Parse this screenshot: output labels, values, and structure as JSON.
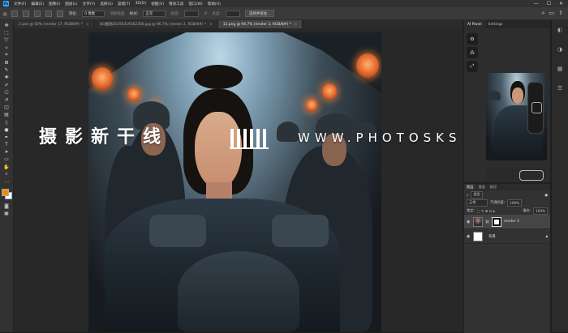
{
  "app": {
    "logo": "Ps"
  },
  "menu": [
    "文件(F)",
    "编辑(E)",
    "图像(I)",
    "图层(L)",
    "文字(Y)",
    "选择(S)",
    "滤镜(T)",
    "3D(D)",
    "视图(V)",
    "增效工具",
    "窗口(W)",
    "帮助(H)"
  ],
  "window_controls": [
    "—",
    "☐",
    "✕"
  ],
  "options": {
    "feather_label": "羽化:",
    "feather_value": "0 像素",
    "antialias_label": "消除锯齿",
    "style_label": "样式:",
    "style_value": "正常",
    "width_label": "宽度:",
    "height_label": "高度:",
    "select_mask_button": "选择并遮住..."
  },
  "tabs": [
    {
      "label": "2.psd @ 50% (render 17, RGB/8#) *",
      "active": false
    },
    {
      "label": "QQ截图20250319162356.jpg @ 66.7% (render 2, RGB/8#) *",
      "active": false
    },
    {
      "label": "11.png @ 94.7% (render 3, RGB/8#) *",
      "active": true
    }
  ],
  "watermark": {
    "cn": "摄影新干线",
    "en": "WWW.PHOTOSKS.VIP"
  },
  "ai_panel": {
    "tabs": [
      "AI Panel",
      "Settings"
    ],
    "side_icons": [
      "gear-icon",
      "tree-icon",
      "expand-icon"
    ]
  },
  "layers_panel": {
    "tabs": [
      "图层",
      "通道",
      "路径"
    ],
    "filter_label": "类型",
    "blend_mode": "正常",
    "opacity_label": "不透明度:",
    "opacity_value": "100%",
    "lock_label": "锁定:",
    "fill_label": "填充:",
    "fill_value": "100%",
    "layers": [
      {
        "name": "render 3",
        "active": true,
        "has_mask": true
      },
      {
        "name": "背景",
        "active": false,
        "has_mask": false,
        "locked": true
      }
    ]
  }
}
